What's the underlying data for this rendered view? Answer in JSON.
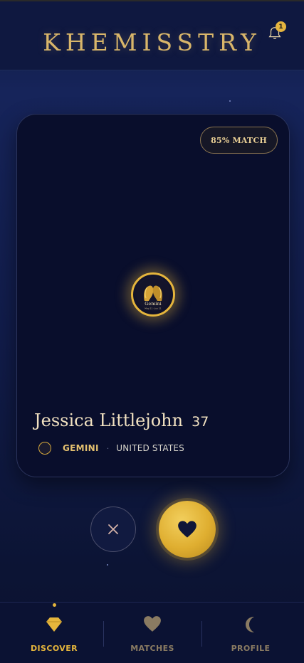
{
  "app": {
    "title": "KHEMISSTRY"
  },
  "notifications": {
    "count": "1",
    "icon": "bell-icon"
  },
  "profile_card": {
    "match": "85% MATCH",
    "name": "Jessica Littlejohn",
    "age": "37",
    "sign": "GEMINI",
    "separator": "·",
    "country": "UNITED STATES",
    "emblem_text": "Gemini",
    "emblem_dates": "May 21 - Jun 21"
  },
  "actions": {
    "pass_icon": "close-icon",
    "like_icon": "heart-icon"
  },
  "nav": {
    "items": [
      {
        "label": "DISCOVER",
        "icon": "diamond-icon",
        "active": true
      },
      {
        "label": "MATCHES",
        "icon": "heart-icon",
        "active": false
      },
      {
        "label": "PROFILE",
        "icon": "moon-icon",
        "active": false
      }
    ]
  },
  "colors": {
    "gold": "#e5b53c",
    "background": "#111c4a",
    "card": "#090e2c",
    "inactive": "#8a7b62"
  }
}
